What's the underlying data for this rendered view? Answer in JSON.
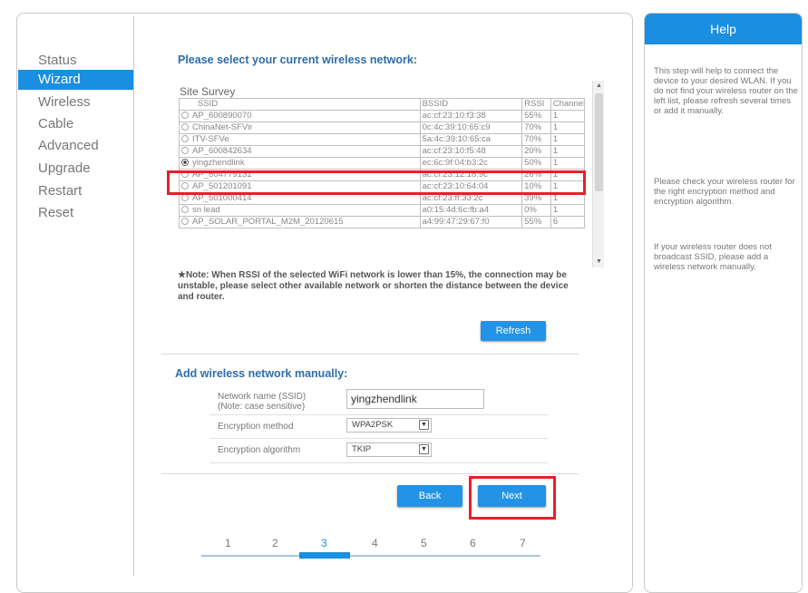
{
  "nav": {
    "items": [
      "Status",
      "Wizard",
      "Wireless",
      "Cable",
      "Advanced",
      "Upgrade",
      "Restart",
      "Reset"
    ],
    "active": "Wizard"
  },
  "wizard": {
    "title": "Please select your current wireless network:",
    "survey_label": "Site Survey",
    "columns": [
      "SSID",
      "BSSID",
      "RSSI",
      "Channel"
    ],
    "rows": [
      {
        "ssid": "AP_600890070",
        "bssid": "ac:cf:23:10:f3:38",
        "rssi": "55%",
        "channel": "1"
      },
      {
        "ssid": "ChinaNet-SFVir",
        "bssid": "0c:4c:39:10:65:c9",
        "rssi": "70%",
        "channel": "1"
      },
      {
        "ssid": "ITV-SFVe",
        "bssid": "5a:4c:39:10:65:ca",
        "rssi": "70%",
        "channel": "1"
      },
      {
        "ssid": "AP_600842634",
        "bssid": "ac:cf:23:10:f5:48",
        "rssi": "20%",
        "channel": "1"
      },
      {
        "ssid": "yingzhendlink",
        "bssid": "ec:6c:9f:04:b3:2c",
        "rssi": "50%",
        "channel": "1"
      },
      {
        "ssid": "AP_604779131",
        "bssid": "ac:cf:23:12:18:9c",
        "rssi": "26%",
        "channel": "1"
      },
      {
        "ssid": "AP_501201091",
        "bssid": "ac:cf:23:10:64:04",
        "rssi": "10%",
        "channel": "1"
      },
      {
        "ssid": "AP_501000414",
        "bssid": "ac:cf:23:ff:33:2c",
        "rssi": "39%",
        "channel": "1"
      },
      {
        "ssid": "sn lead",
        "bssid": "a0:15:4d:6c:fb:a4",
        "rssi": "0%",
        "channel": "1"
      },
      {
        "ssid": "AP_SOLAR_PORTAL_M2M_20120615",
        "bssid": "a4:99:47:29:67:f0",
        "rssi": "55%",
        "channel": "6"
      }
    ],
    "selected_index": 4,
    "note": "★Note: When RSSI of the selected WiFi network is lower than 15%, the connection may be unstable, please select other available network or shorten the distance between the device and router.",
    "refresh_label": "Refresh",
    "manual_title": "Add wireless network manually:",
    "ssid_label": "Network name (SSID)",
    "ssid_note": "(Note: case sensitive)",
    "ssid_value": "yingzhendlink",
    "enc_method_label": "Encryption method",
    "enc_method_value": "WPA2PSK",
    "enc_algo_label": "Encryption algorithm",
    "enc_algo_value": "TKIP",
    "back_label": "Back",
    "next_label": "Next",
    "steps": [
      "1",
      "2",
      "3",
      "4",
      "5",
      "6",
      "7"
    ],
    "current_step": "3"
  },
  "help": {
    "title": "Help",
    "p1": "This step will help to connect the device to your desired WLAN. If you do not find your wireless router on the left list, please refresh several times or add it manually.",
    "p2": "Please check your wireless router for the right encryption method and encryption algorithm.",
    "p3": "If your wireless router does not broadcast SSID, please add a wireless network manually."
  },
  "colors": {
    "accent": "#1a8ee0",
    "title_blue": "#2c6ea9",
    "highlight_red": "#e6202a"
  },
  "icons": {
    "dropdown": "triangle-down",
    "scroll_up": "triangle-up",
    "scroll_down": "triangle-down"
  }
}
